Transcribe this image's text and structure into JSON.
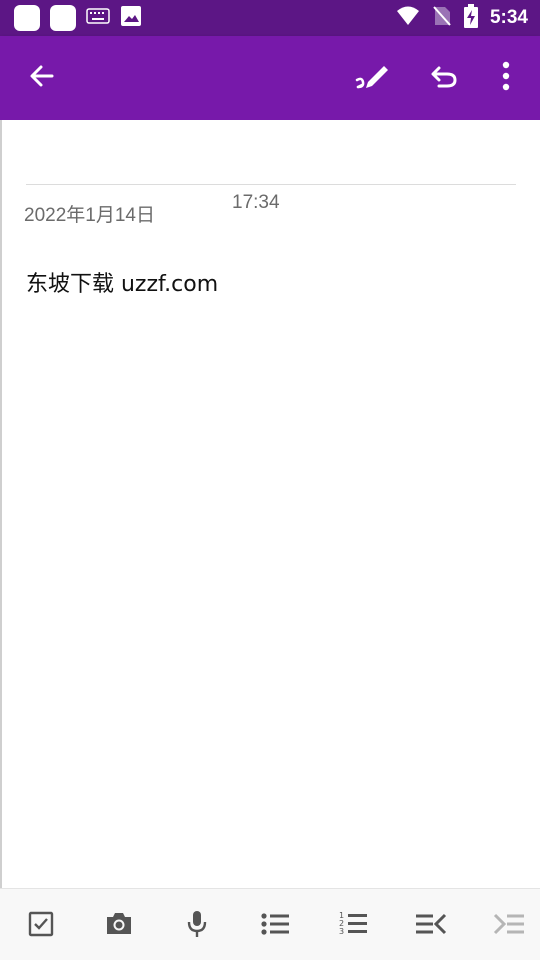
{
  "status_bar": {
    "time": "5:34",
    "icons": [
      "app-square-icon",
      "app-square-icon",
      "keyboard-icon",
      "image-icon",
      "wifi-icon",
      "no-sim-icon",
      "battery-charging-icon"
    ]
  },
  "app_bar": {
    "background": "#7719aa",
    "icons": [
      "back-arrow-icon",
      "pen-icon",
      "undo-icon",
      "more-vert-icon"
    ]
  },
  "note": {
    "date": "2022年1月14日",
    "time": "17:34",
    "body": "东坡下载 uzzf.com"
  },
  "toolbar": {
    "icons": [
      "checkbox-icon",
      "camera-icon",
      "microphone-icon",
      "bullet-list-icon",
      "numbered-list-icon",
      "outdent-icon",
      "indent-icon"
    ]
  }
}
